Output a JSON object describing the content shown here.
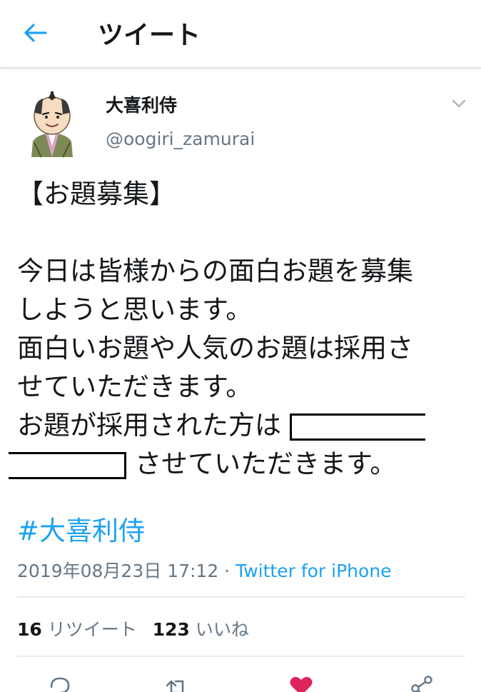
{
  "header": {
    "title": "ツイート",
    "back_icon": "arrow-left-icon",
    "accent": "#1da1f2"
  },
  "tweet": {
    "author": {
      "name": "大喜利侍",
      "handle": "@oogiri_zamurai"
    },
    "text_lines": [
      "【お題募集】",
      "",
      "今日は皆様からの面白お題を募集",
      "しようと思います。",
      "面白いお題や人気のお題は採用さ",
      "せていただきます。",
      "お題が採用された方は",
      "させていただきます。"
    ],
    "hashtag": "#大喜利侍",
    "timestamp": "2019年08月23日 17:12 · ",
    "source": "Twitter for iPhone",
    "stats": {
      "retweets": "16",
      "retweets_label": "リツイート",
      "likes": "123",
      "likes_label": "いいね"
    }
  },
  "actions": [
    "reply-icon",
    "retweet-icon",
    "like-icon",
    "share-icon"
  ],
  "colors": {
    "link": "#1da1f2",
    "secondary": "#657786",
    "like": "#e0245e"
  }
}
